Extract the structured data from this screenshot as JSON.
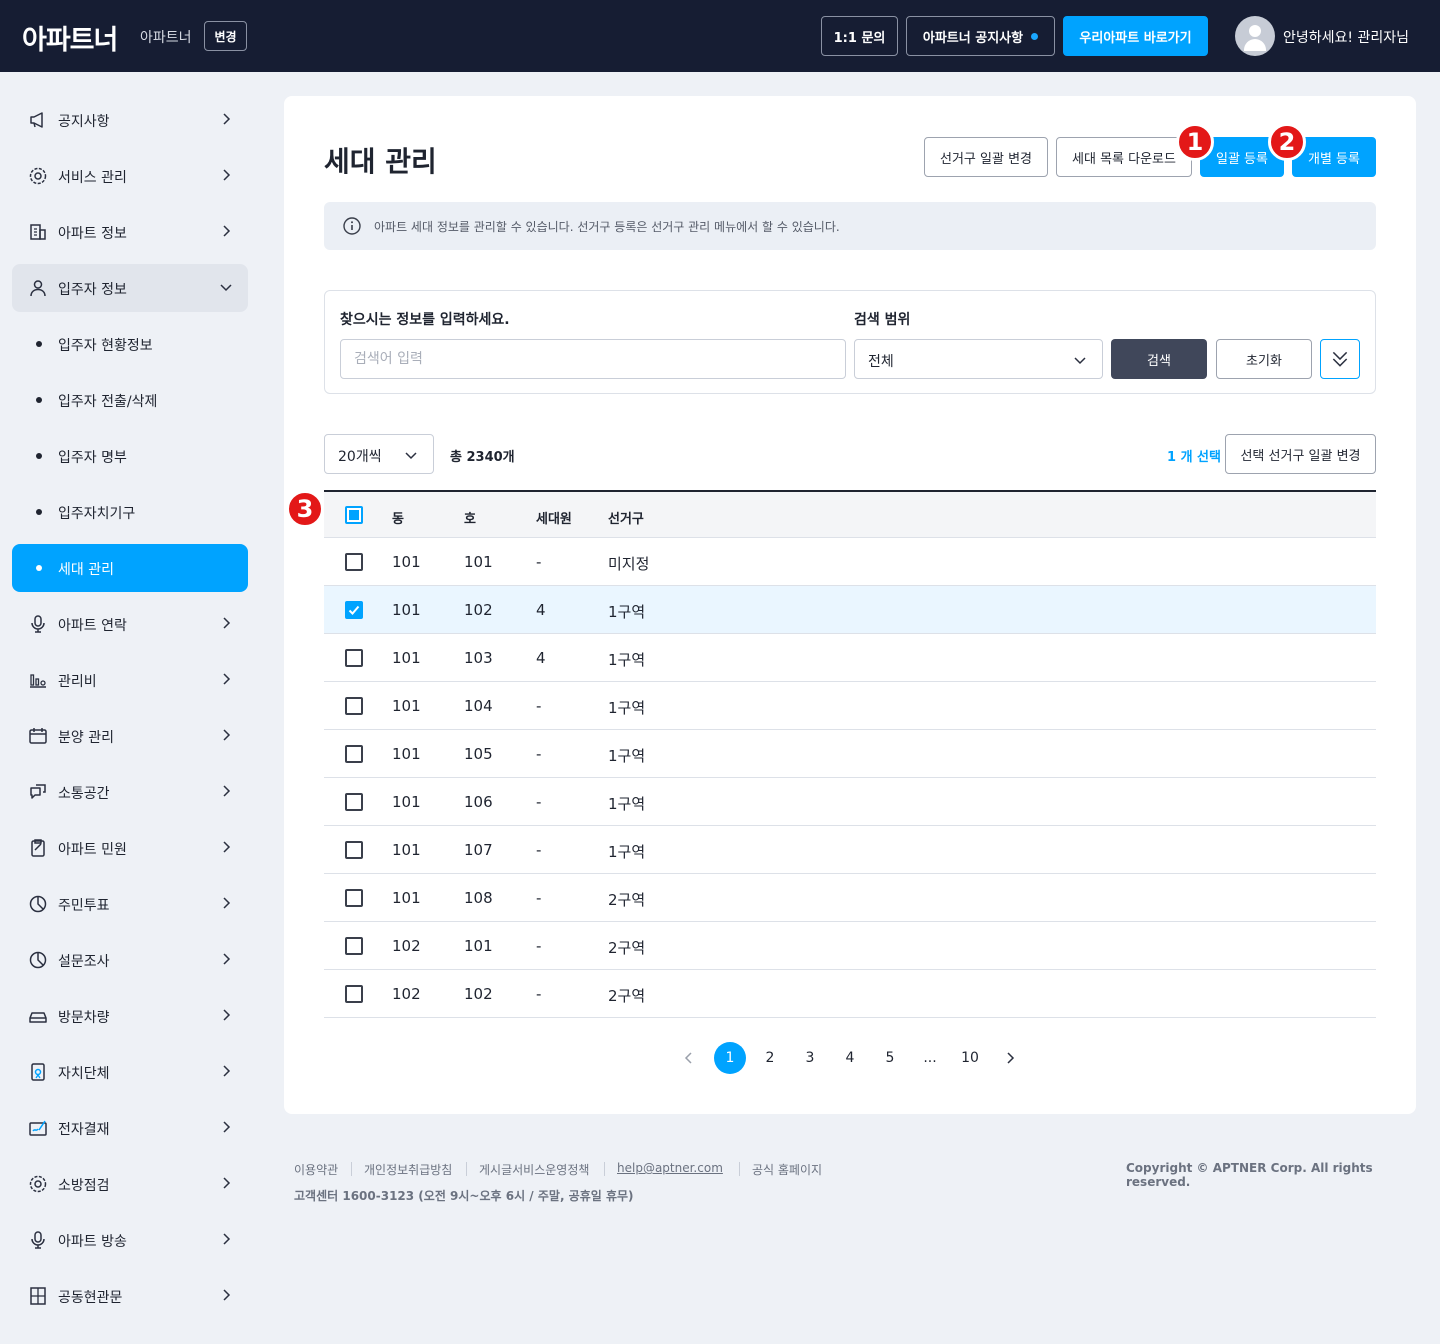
{
  "header": {
    "logo": "아파트너",
    "apt_name": "아파트너",
    "change_label": "변경",
    "inquiry_label": "1:1 문의",
    "notice_label": "아파트너 공지사항",
    "go_apt_label": "우리아파트 바로가기",
    "greeting": "안녕하세요! 관리자님"
  },
  "sidebar": {
    "items": [
      {
        "label": "공지사항",
        "icon": "megaphone-icon"
      },
      {
        "label": "서비스 관리",
        "icon": "gear-icon"
      },
      {
        "label": "아파트 정보",
        "icon": "building-icon"
      },
      {
        "label": "입주자 정보",
        "icon": "person-icon"
      },
      {
        "label": "입주자 현황정보"
      },
      {
        "label": "입주자 전출/삭제"
      },
      {
        "label": "입주자 명부"
      },
      {
        "label": "입주자치기구"
      },
      {
        "label": "세대 관리"
      },
      {
        "label": "아파트 연락",
        "icon": "microphone-icon"
      },
      {
        "label": "관리비",
        "icon": "bar-chart-icon"
      },
      {
        "label": "분양 관리",
        "icon": "calendar-icon"
      },
      {
        "label": "소통공간",
        "icon": "chat-icon"
      },
      {
        "label": "아파트 민원",
        "icon": "clipboard-icon"
      },
      {
        "label": "주민투표",
        "icon": "pie-icon"
      },
      {
        "label": "설문조사",
        "icon": "pie-icon"
      },
      {
        "label": "방문차량",
        "icon": "car-icon"
      },
      {
        "label": "자치단체",
        "icon": "badge-icon"
      },
      {
        "label": "전자결재",
        "icon": "sign-icon"
      },
      {
        "label": "소방점검",
        "icon": "gear-icon"
      },
      {
        "label": "아파트 방송",
        "icon": "microphone-icon"
      },
      {
        "label": "공동현관문",
        "icon": "door-icon"
      }
    ]
  },
  "main": {
    "title": "세대 관리",
    "buttons": {
      "district_bulk_change": "선거구 일괄 변경",
      "download_list": "세대 목록 다운로드",
      "bulk_register": "일괄 등록",
      "single_register": "개별 등록"
    },
    "markers": [
      "1",
      "2",
      "3"
    ],
    "info_text": "아파트 세대 정보를 관리할 수 있습니다. 선거구 등록은 선거구 관리 메뉴에서 할 수 있습니다.",
    "search": {
      "label": "찾으시는 정보를 입력하세요.",
      "placeholder": "검색어 입력",
      "scope_label": "검색 범위",
      "scope_value": "전체",
      "search_button": "검색",
      "reset_button": "초기화"
    },
    "list": {
      "per_page": "20개씩",
      "total": "총 2340개",
      "selected": "1 개 선택",
      "selected_change_button": "선택 선거구 일괄 변경"
    },
    "table": {
      "columns": [
        "동",
        "호",
        "세대원",
        "선거구"
      ],
      "rows": [
        {
          "dong": "101",
          "ho": "101",
          "members": "-",
          "district": "미지정",
          "checked": false
        },
        {
          "dong": "101",
          "ho": "102",
          "members": "4",
          "district": "1구역",
          "checked": true
        },
        {
          "dong": "101",
          "ho": "103",
          "members": "4",
          "district": "1구역",
          "checked": false
        },
        {
          "dong": "101",
          "ho": "104",
          "members": "-",
          "district": "1구역",
          "checked": false
        },
        {
          "dong": "101",
          "ho": "105",
          "members": "-",
          "district": "1구역",
          "checked": false
        },
        {
          "dong": "101",
          "ho": "106",
          "members": "-",
          "district": "1구역",
          "checked": false
        },
        {
          "dong": "101",
          "ho": "107",
          "members": "-",
          "district": "1구역",
          "checked": false
        },
        {
          "dong": "101",
          "ho": "108",
          "members": "-",
          "district": "2구역",
          "checked": false
        },
        {
          "dong": "102",
          "ho": "101",
          "members": "-",
          "district": "2구역",
          "checked": false
        },
        {
          "dong": "102",
          "ho": "102",
          "members": "-",
          "district": "2구역",
          "checked": false
        }
      ]
    },
    "pagination": {
      "pages": [
        "1",
        "2",
        "3",
        "4",
        "5",
        "...",
        "10"
      ],
      "current": "1"
    }
  },
  "footer": {
    "links": [
      "이용약관",
      "개인정보취급방침",
      "게시글서비스운영정책",
      "help@aptner.com",
      "공식 홈페이지"
    ],
    "support": "고객센터 1600-3123 (오전 9시~오후 6시 / 주말, 공휴일 휴무)",
    "copyright": "Copyright © APTNER Corp. All rights reserved."
  },
  "colors": {
    "header_bg": "#161d33",
    "accent": "#00a3ff",
    "marker": "#e31818",
    "page_bg": "#eef1f6"
  }
}
